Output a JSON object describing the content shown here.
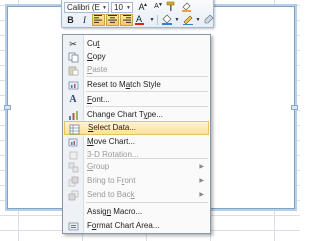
{
  "mini_toolbar": {
    "font_name": "Calibri (E",
    "font_size": "10",
    "buttons": {
      "grow_font": "A",
      "shrink_font": "A",
      "bold": "B",
      "italic": "I",
      "font_color": "A"
    }
  },
  "menu": {
    "items": [
      {
        "id": "cut",
        "pre": "Cu",
        "key": "t",
        "post": "",
        "disabled": false,
        "submenu": false,
        "icon": "scissors-icon"
      },
      {
        "id": "copy",
        "pre": "",
        "key": "C",
        "post": "opy",
        "disabled": false,
        "submenu": false,
        "icon": "copy-icon"
      },
      {
        "id": "paste",
        "pre": "",
        "key": "P",
        "post": "aste",
        "disabled": true,
        "submenu": false,
        "icon": "paste-icon"
      },
      {
        "id": "reset-style",
        "pre": "Reset to M",
        "key": "a",
        "post": "tch Style",
        "disabled": false,
        "submenu": false,
        "icon": "reset-style-icon"
      },
      {
        "id": "font",
        "pre": "",
        "key": "F",
        "post": "ont...",
        "disabled": false,
        "submenu": false,
        "icon": "font-icon"
      },
      {
        "id": "change-chart",
        "pre": "Change Chart T",
        "key": "y",
        "post": "pe...",
        "disabled": false,
        "submenu": false,
        "icon": "chart-type-icon"
      },
      {
        "id": "select-data",
        "pre": "",
        "key": "S",
        "post": "elect Data...",
        "disabled": false,
        "submenu": false,
        "icon": "select-data-icon"
      },
      {
        "id": "move-chart",
        "pre": "",
        "key": "M",
        "post": "ove Chart...",
        "disabled": false,
        "submenu": false,
        "icon": "move-chart-icon"
      },
      {
        "id": "3d-rotation",
        "pre": "3-D ",
        "key": "R",
        "post": "otation...",
        "disabled": true,
        "submenu": false,
        "icon": "rotation-icon"
      },
      {
        "id": "group",
        "pre": "",
        "key": "G",
        "post": "roup",
        "disabled": true,
        "submenu": true,
        "icon": "group-icon"
      },
      {
        "id": "bring-front",
        "pre": "Bring to F",
        "key": "r",
        "post": "ont",
        "disabled": true,
        "submenu": true,
        "icon": "bring-front-icon"
      },
      {
        "id": "send-back",
        "pre": "Send to Bac",
        "key": "k",
        "post": "",
        "disabled": true,
        "submenu": true,
        "icon": "send-back-icon"
      },
      {
        "id": "assign-macro",
        "pre": "Assig",
        "key": "n",
        "post": " Macro...",
        "disabled": false,
        "submenu": false,
        "icon": ""
      },
      {
        "id": "format-chart",
        "pre": "F",
        "key": "o",
        "post": "rmat Chart Area...",
        "disabled": false,
        "submenu": false,
        "icon": "format-chart-icon"
      }
    ],
    "highlighted": "select-data",
    "submenu_arrow": "▶"
  }
}
